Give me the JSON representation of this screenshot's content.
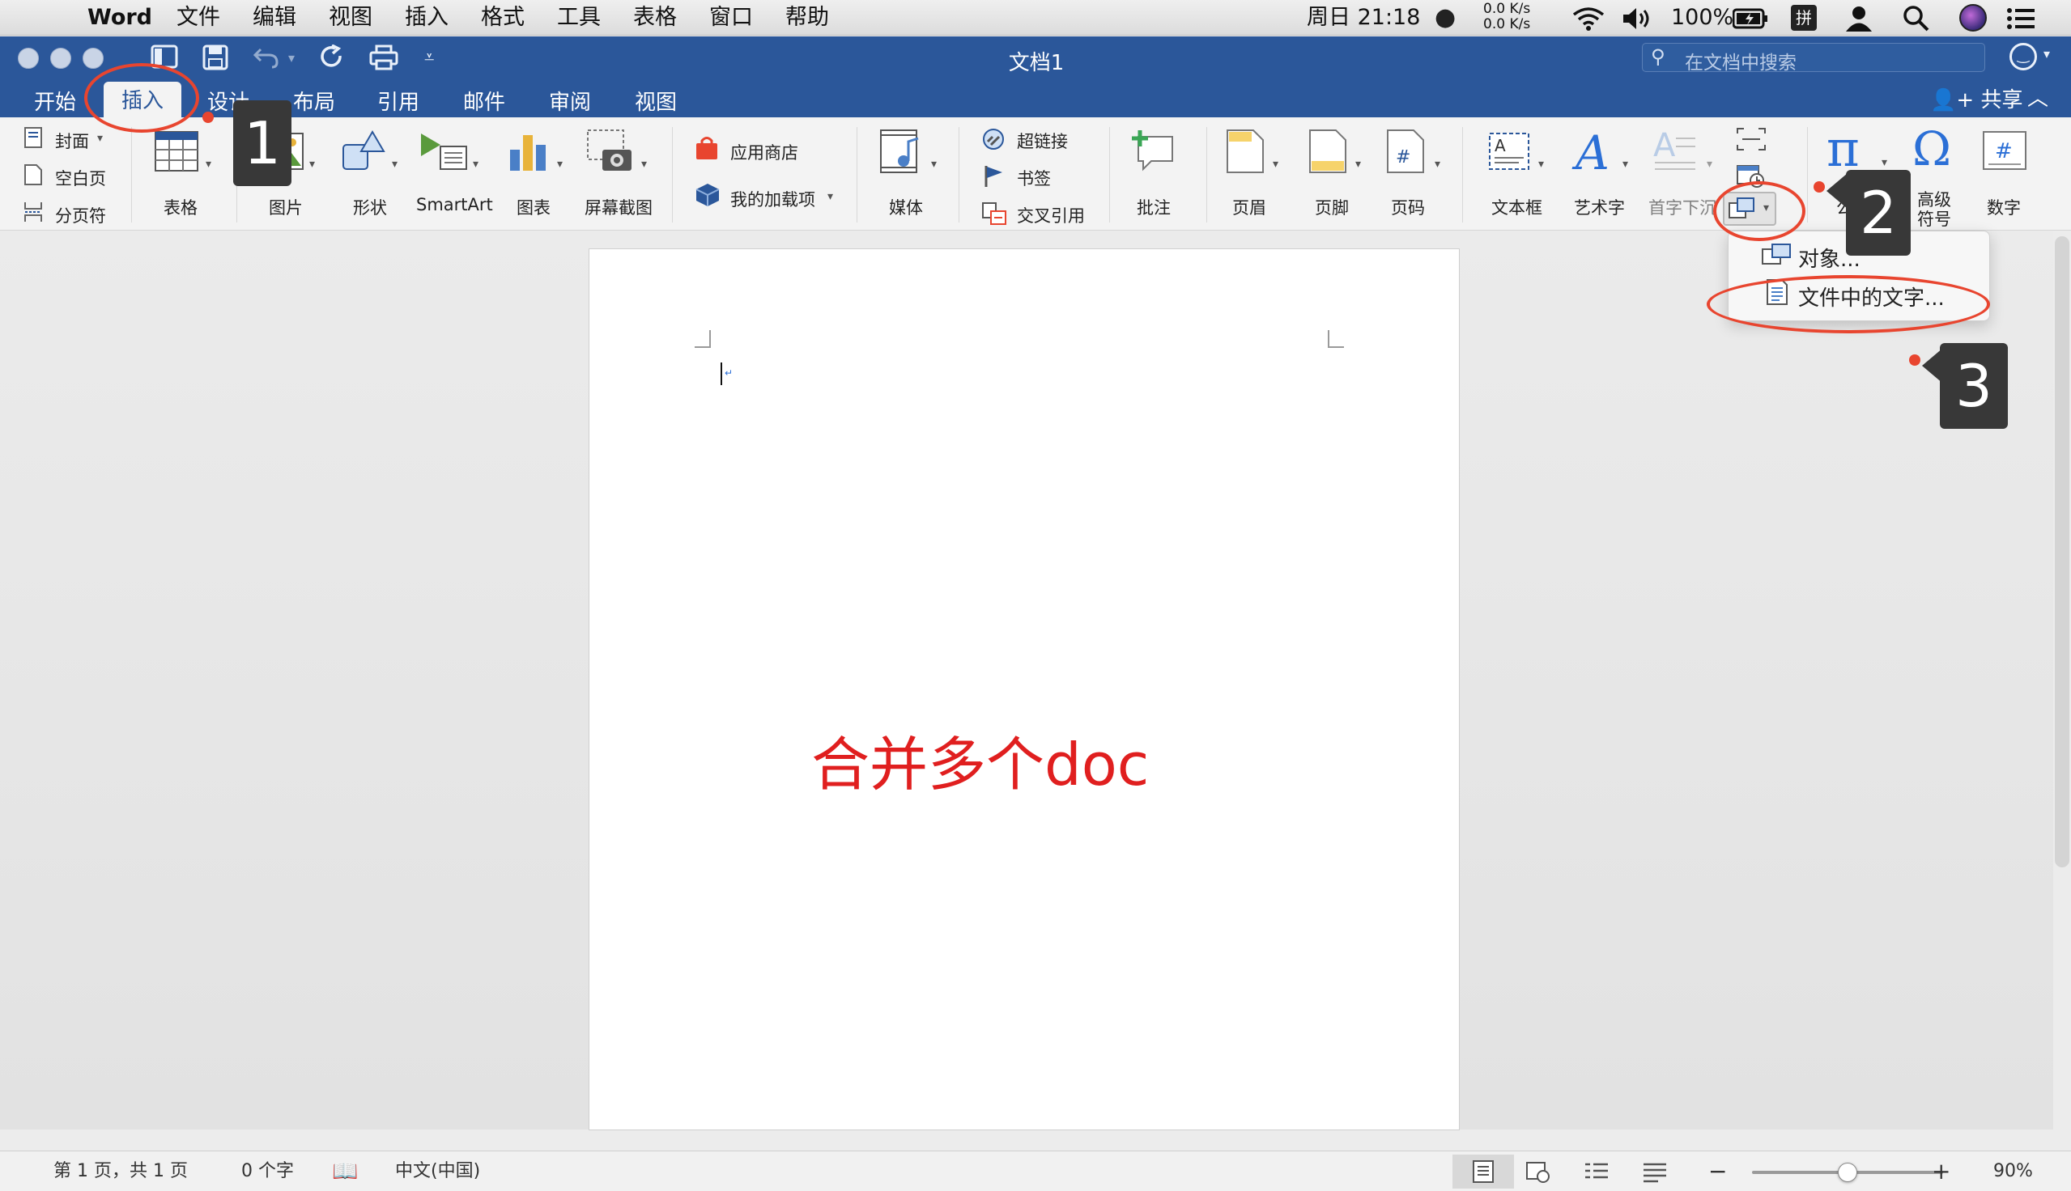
{
  "menubar": {
    "app": "Word",
    "items": [
      "文件",
      "编辑",
      "视图",
      "插入",
      "格式",
      "工具",
      "表格",
      "窗口",
      "帮助"
    ],
    "clock": "周日 21:18",
    "net_up": "0.0 K/s",
    "net_down": "0.0 K/s",
    "battery": "100%",
    "input_method": "拼"
  },
  "window": {
    "title": "文档1",
    "search_placeholder": "在文档中搜索",
    "share": "共享"
  },
  "tabs": [
    "开始",
    "插入",
    "设计",
    "布局",
    "引用",
    "邮件",
    "审阅",
    "视图"
  ],
  "ribbon": {
    "pages": [
      "封面",
      "空白页",
      "分页符"
    ],
    "table": "表格",
    "picture": "图片",
    "shapes": "形状",
    "smartart": "SmartArt",
    "chart": "图表",
    "screenshot": "屏幕截图",
    "store": "应用商店",
    "addins": "我的加载项",
    "media": "媒体",
    "hyperlink": "超链接",
    "bookmark": "书签",
    "crossref": "交叉引用",
    "comment": "批注",
    "header": "页眉",
    "footer": "页脚",
    "page_number": "页码",
    "textbox": "文本框",
    "wordart": "艺术字",
    "dropcap": "首字下沉",
    "equation": "公式",
    "symbol_line1": "高级",
    "symbol_line2": "符号",
    "number": "数字"
  },
  "dropdown": {
    "object": "对象...",
    "text_from_file": "文件中的文字..."
  },
  "document": {
    "body_text": "合并多个doc"
  },
  "annotations": {
    "step1": "1",
    "step2": "2",
    "step3": "3",
    "accent": "#e8452f"
  },
  "statusbar": {
    "page": "第 1 页，共 1 页",
    "words": "0 个字",
    "language": "中文(中国)",
    "zoom": "90%",
    "zoom_level": 0.5
  },
  "colors": {
    "titlebar": "#2b579a",
    "ribbon": "#f3f3f3"
  }
}
